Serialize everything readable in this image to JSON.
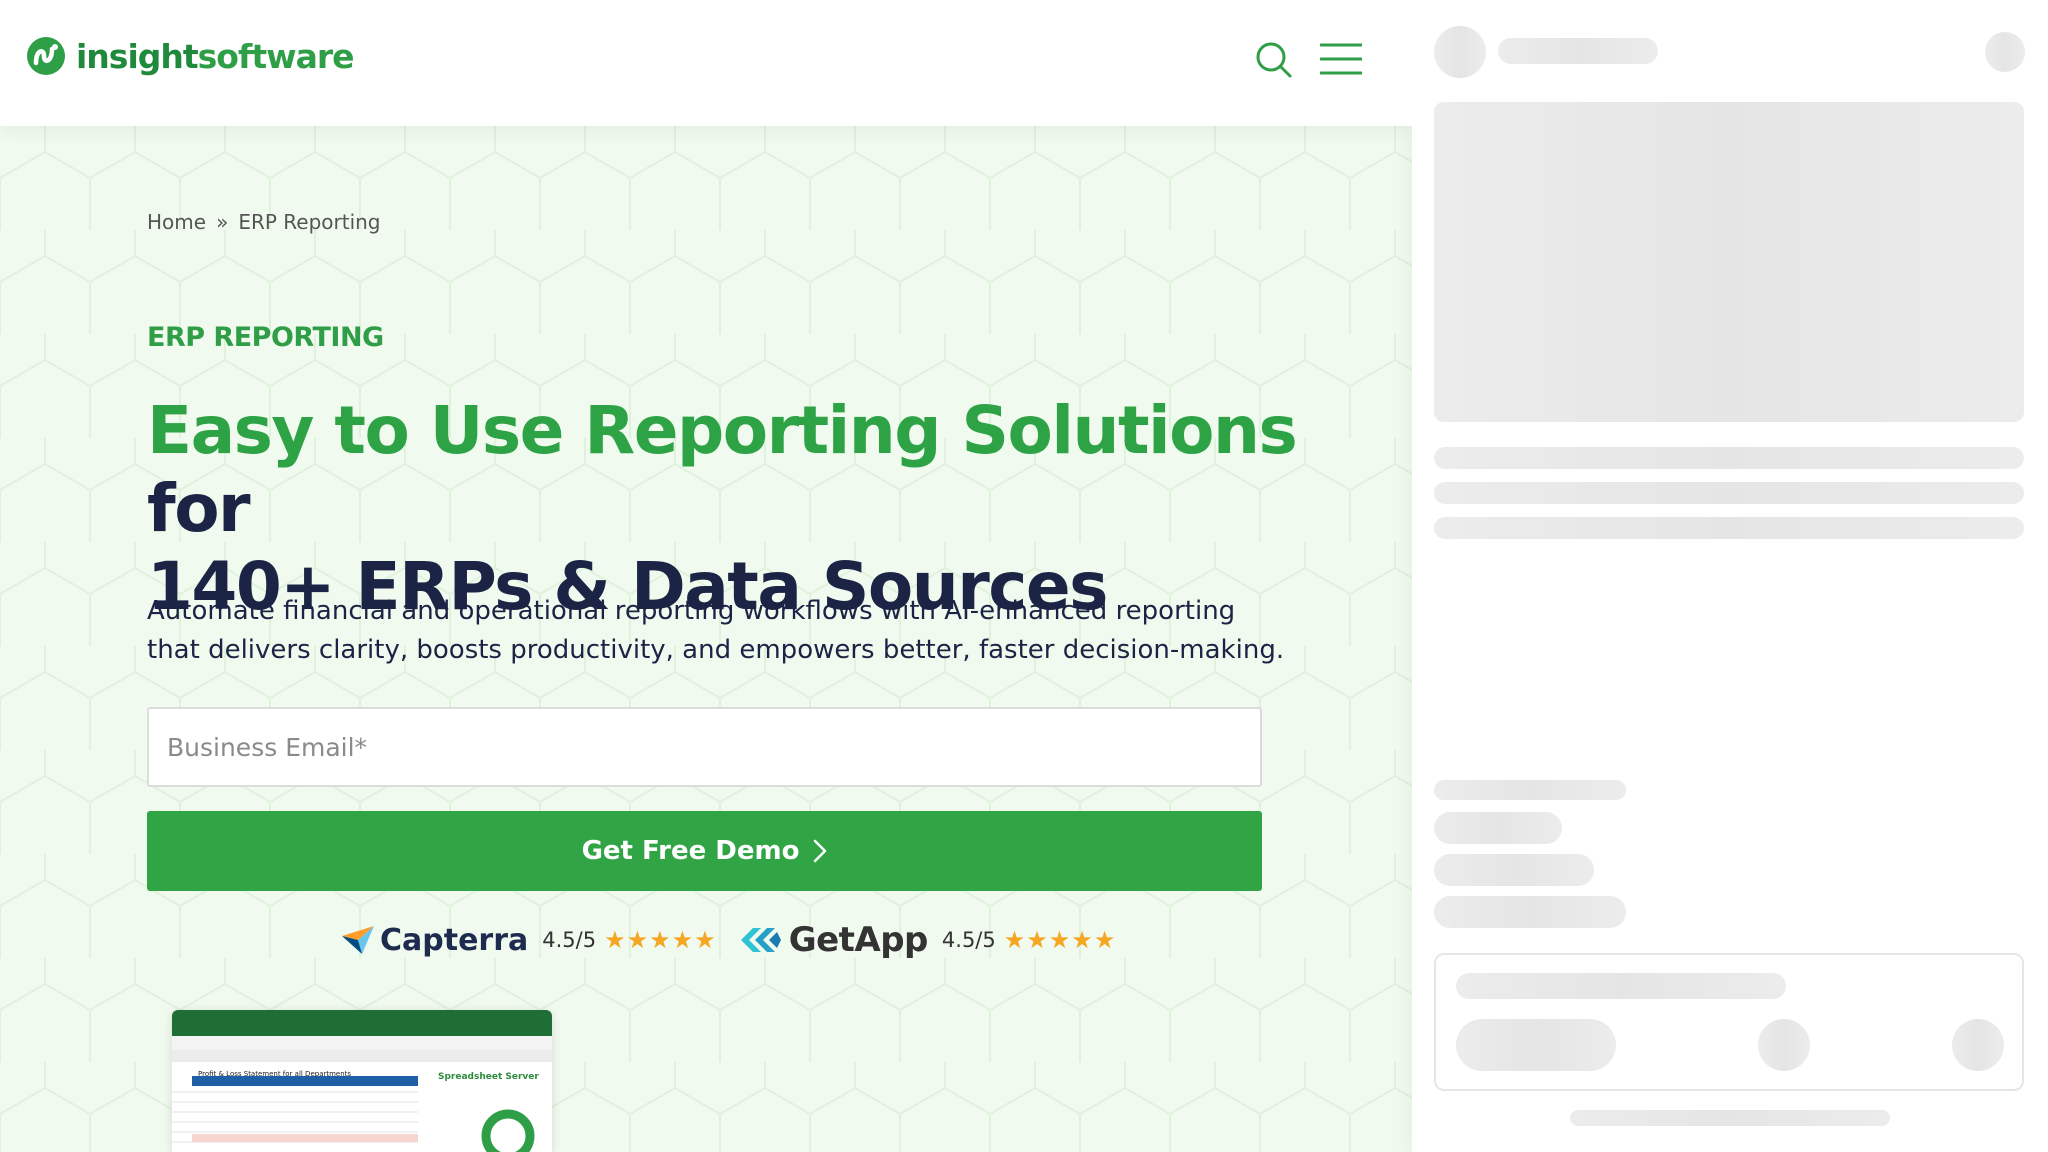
{
  "site": {
    "logo": {
      "part1": "insight",
      "part2": "software"
    },
    "breadcrumb": {
      "home": "Home",
      "separator": "»",
      "current": "ERP Reporting"
    },
    "eyebrow": "ERP REPORTING",
    "headline": {
      "highlight": "Easy to Use Reporting Solutions",
      "rest_line1": " for",
      "line2": "140+ ERPs & Data Sources"
    },
    "lead": "Automate financial and operational reporting workflows with AI-enhanced reporting that delivers clarity, boosts productivity, and empowers better, faster decision-making.",
    "form": {
      "email_placeholder": "Business Email*",
      "email_value": "",
      "cta_label": "Get Free Demo"
    },
    "ratings": [
      {
        "brand": "Capterra",
        "score": "4.5/5",
        "stars": 4.5
      },
      {
        "brand": "GetApp",
        "score": "4.5/5",
        "stars": 4.5
      }
    ],
    "preview": {
      "sheet_title": "Profit & Loss Statement for all Departments",
      "app_label": "Spreadsheet Server"
    }
  },
  "colors": {
    "brand_green": "#31a546",
    "navy": "#1c2446",
    "star": "#f5a623",
    "skeleton": "#ececec"
  },
  "icons": [
    "logo-icon",
    "search-icon",
    "menu-icon",
    "chevron-right-icon",
    "capterra-icon",
    "getapp-icon",
    "star-icon"
  ]
}
